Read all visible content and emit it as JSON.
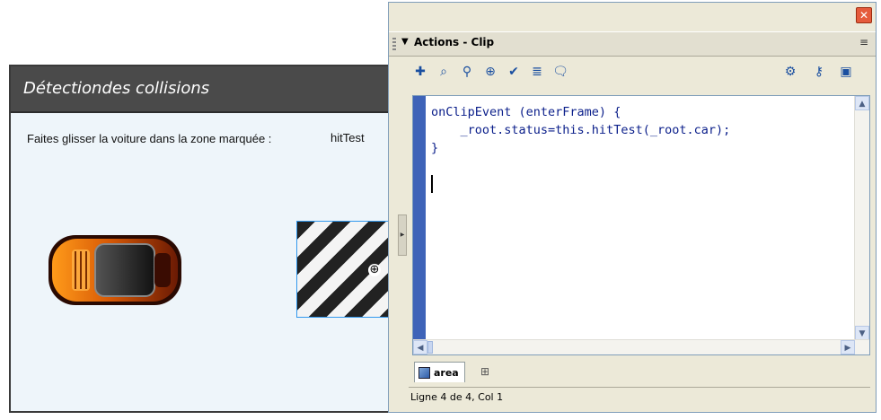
{
  "stage": {
    "title": "Détectiondes collisions",
    "instruction": "Faites glisser la voiture dans la zone marquée :",
    "status_label": "hitTest",
    "crosshair": "⊕"
  },
  "panel": {
    "close_label": "✕",
    "collapse_icon": "▼",
    "title": "Actions - Clip",
    "menu_icon": "≡",
    "toolbar": [
      {
        "icon": "add-statement-icon",
        "glyph": "✚"
      },
      {
        "icon": "find-icon",
        "glyph": "⌕"
      },
      {
        "icon": "replace-icon",
        "glyph": "⚲"
      },
      {
        "icon": "target-path-icon",
        "glyph": "⊕"
      },
      {
        "icon": "check-syntax-icon",
        "glyph": "✔"
      },
      {
        "icon": "auto-format-icon",
        "glyph": "≣"
      },
      {
        "icon": "code-hint-icon",
        "glyph": "🗨"
      },
      {
        "icon": "debug-options-icon",
        "glyph": "⚙"
      },
      {
        "icon": "reference-icon",
        "glyph": "⚷"
      },
      {
        "icon": "script-assist-icon",
        "glyph": "▣"
      }
    ],
    "code": "onClipEvent (enterFrame) {\n    _root.status=this.hitTest(_root.car);\n}",
    "tab_label": "area",
    "pin_icon": "⊞",
    "status_text": "Ligne 4 de 4, Col 1"
  },
  "colors": {
    "gutter": "#3e63b8",
    "code": "#0a1e8a",
    "stage_header": "#4a4a4a",
    "stage_bg": "#eef5fa"
  }
}
